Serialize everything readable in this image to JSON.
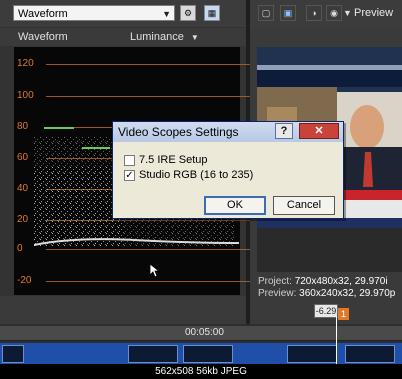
{
  "toolbar": {
    "scope_select_value": "Waveform",
    "preview_label": "Preview"
  },
  "scope": {
    "title": "Waveform",
    "mode_dropdown": "Luminance",
    "y_labels": [
      "120",
      "100",
      "80",
      "60",
      "40",
      "20",
      "0",
      "-20"
    ]
  },
  "preview": {
    "project_label": "Project:",
    "project_value": "720x480x32, 29.970i",
    "preview_label": "Preview:",
    "preview_value": "360x240x32, 29.970p"
  },
  "timeline": {
    "ruler_time": "00:05:00",
    "time_badge": "-6.29",
    "marker_badge": "1"
  },
  "caption": "562x508 56kb JPEG",
  "dialog": {
    "title": "Video Scopes Settings",
    "help_label": "?",
    "close_label": "✕",
    "option_1_label": "7.5 IRE Setup",
    "option_1_checked": false,
    "option_2_label": "Studio RGB (16 to 235)",
    "option_2_checked": true,
    "ok_label": "OK",
    "cancel_label": "Cancel"
  },
  "colors": {
    "accent": "#e07a28",
    "dialog_face": "#ece9d8",
    "close_red": "#c8433a",
    "clip_blue": "#1f4fa8"
  }
}
